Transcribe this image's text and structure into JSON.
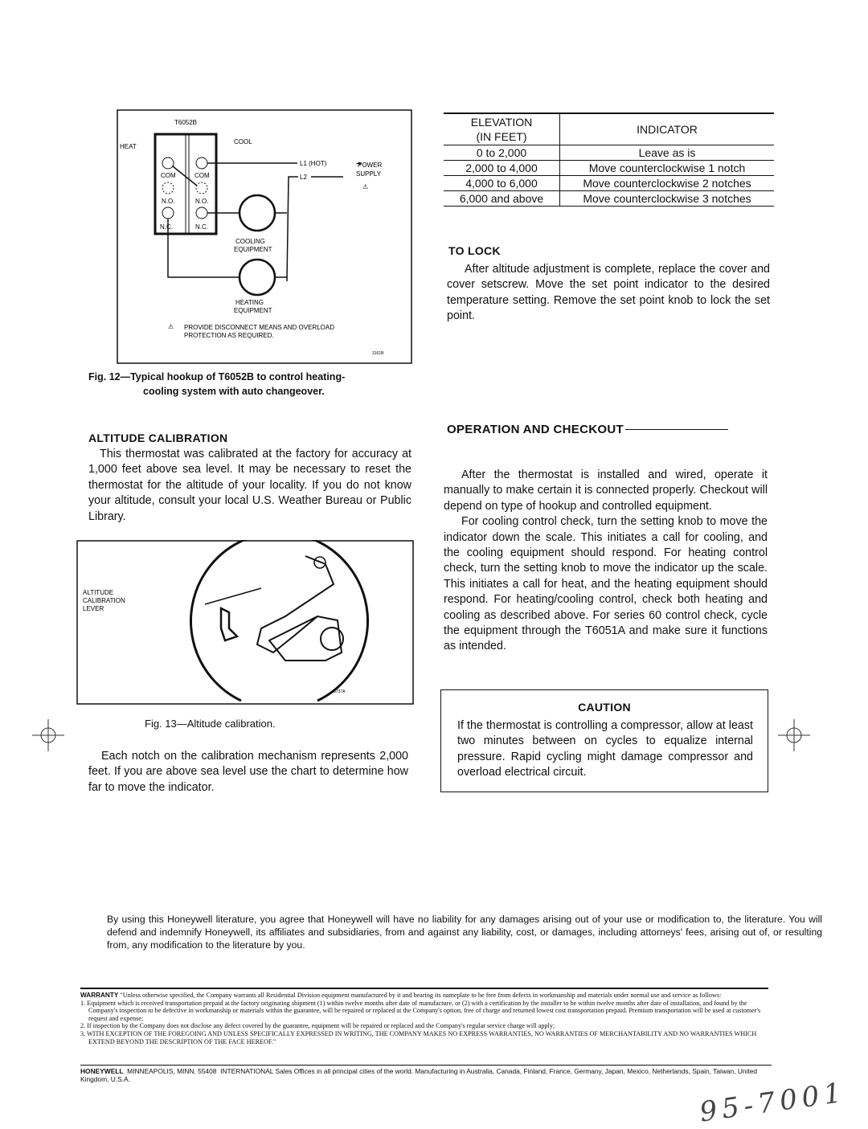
{
  "fig12": {
    "model": "T6052B",
    "heat": "HEAT",
    "cool": "COOL",
    "com": "COM",
    "no": "N.O.",
    "nc": "N.C.",
    "l1": "L1 (HOT)",
    "l2": "L2",
    "power_supply_1": "POWER",
    "power_supply_2": "SUPPLY",
    "cooling_1": "COOLING",
    "cooling_2": "EQUIPMENT",
    "heating_1": "HEATING",
    "heating_2": "EQUIPMENT",
    "note_1": "PROVIDE DISCONNECT MEANS AND OVERLOAD",
    "note_2": "PROTECTION AS REQUIRED.",
    "note_marker": "1",
    "code": "3161B",
    "caption_1": "Fig. 12—Typical hookup of T6052B to control heating-",
    "caption_2": "cooling system with auto changeover."
  },
  "altitude": {
    "heading": "ALTITUDE CALIBRATION",
    "paragraph": "This thermostat was calibrated at the factory for accuracy at 1,000 feet above sea level. It may be necessary to reset the thermostat for the altitude of your locality. If you do not know your altitude, consult your local U.S. Weather Bureau or Public Library."
  },
  "fig13": {
    "label_1": "ALTITUDE",
    "label_2": "CALIBRATION",
    "label_3": "LEVER",
    "code": "3737A",
    "caption": "Fig. 13—Altitude calibration."
  },
  "notch_paragraph": "Each notch on the calibration mechanism represents 2,000 feet. If you are above sea level use the chart to determine how far to move the indicator.",
  "elevation_table": {
    "header_elevation_1": "ELEVATION",
    "header_elevation_2": "(IN FEET)",
    "header_indicator": "INDICATOR",
    "rows": [
      {
        "elevation": "0 to 2,000",
        "indicator": "Leave as is"
      },
      {
        "elevation": "2,000 to 4,000",
        "indicator": "Move counterclockwise 1 notch"
      },
      {
        "elevation": "4,000 to 6,000",
        "indicator": "Move counterclockwise 2 notches"
      },
      {
        "elevation": "6,000 and above",
        "indicator": "Move counterclockwise 3 notches"
      }
    ]
  },
  "to_lock": {
    "heading": "TO LOCK",
    "paragraph": "After altitude adjustment is complete, replace the cover and cover setscrew. Move the set point indicator to the desired temperature setting. Remove the set point knob to lock the set point."
  },
  "operation": {
    "heading": "OPERATION AND CHECKOUT",
    "p1": "After the thermostat is installed and wired, operate it manually to make certain it is connected properly. Checkout will depend on type of hookup and controlled equipment.",
    "p2": "For cooling control check, turn the setting knob to move the indicator down the scale. This initiates a call for cooling, and the cooling equipment should respond. For heating control check, turn the setting knob to move the indicator up the scale. This initiates a call for heat, and the heating equipment should respond. For heating/cooling control, check both heating and cooling as described above. For series 60 control check, cycle the equipment through the T6051A and make sure it functions as intended."
  },
  "caution": {
    "heading": "CAUTION",
    "text": "If the thermostat is controlling a compressor, allow at least two minutes between on cycles to equalize internal pressure. Rapid cycling might damage compressor and overload electrical circuit."
  },
  "disclaimer": "By using this Honeywell literature, you agree that Honeywell will have no liability for any damages arising out of your use or modification to, the literature. You will defend and indemnify Honeywell, its affiliates and subsidiaries, from and against any liability, cost, or damages, including attorneys' fees, arising out of, or resulting from, any modification to the literature by you.",
  "warranty": {
    "label": "WARRANTY",
    "intro": "\"Unless otherwise specified, the Company warrants all Residential Division equipment manufactured by it and bearing its nameplate to be free from defects in workmanship and materials under normal use and service as follows:",
    "items": [
      "1. Equipment which is received transportation prepaid at the factory originating shipment (1) within twelve months after date of manufacture, or (2) with a certification by the installer to be within twelve months after date of installation, and found by the Company's inspection to be defective in workmanship or materials within the guarantee, will be repaired or replaced at the Company's option, free of charge and returned lowest cost transportation prepaid. Premium transportation will be used at customer's request and expense;",
      "2. If inspection by the Company does not disclose any defect covered by the guarantee, equipment will be repaired or replaced and the Company's regular service charge will apply;",
      "3. WITH EXCEPTION OF THE FOREGOING AND UNLESS SPECIFICALLY EXPRESSED IN WRITING, THE COMPANY MAKES NO EXPRESS WARRANTIES, NO WARRANTIES OF MERCHANTABILITY AND NO WARRANTIES WHICH EXTEND BEYOND THE DESCRIPTION OF THE FACE HEREOF.\""
    ]
  },
  "footer": {
    "company": "HONEYWELL",
    "address": "MINNEAPOLIS, MINN. 55408",
    "intl": "INTERNATIONAL",
    "offices": "Sales Offices in all principal cities of the world. Manufacturing in Australia, Canada, Finland, France, Germany, Japan, Mexico, Netherlands, Spain, Taiwan, United Kingdom, U.S.A."
  },
  "handwriting": "95-7001"
}
